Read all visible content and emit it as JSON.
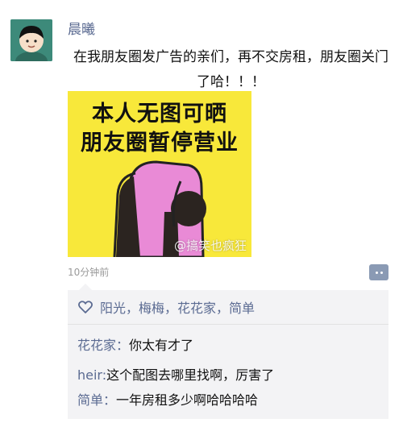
{
  "post": {
    "username": "晨曦",
    "text": "在我朋友圈发广告的亲们，再不交房租，朋友圈关门了哈！！！",
    "image": {
      "line1": "本人无图可晒",
      "line2": "朋友圈暂停营业",
      "watermark": "@搞笑也疯狂"
    },
    "timestamp": "10分钟前",
    "colors": {
      "link": "#5b6b92",
      "image_bg": "#f8e83a",
      "figure": "#e98ad6"
    }
  },
  "likes": {
    "icon": "heart-outline-icon",
    "names": "阳光，梅梅，花花家，简单"
  },
  "comments": [
    {
      "author": "花花家：",
      "text": "你太有才了"
    },
    {
      "author": "heir:",
      "text": "这个配图去哪里找啊，厉害了"
    },
    {
      "author": "简单：",
      "text": "一年房租多少啊哈哈哈哈"
    }
  ]
}
